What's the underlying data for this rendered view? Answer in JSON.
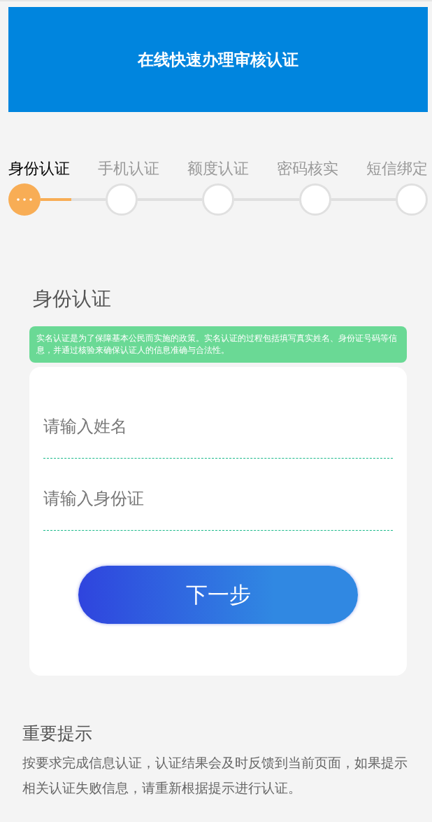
{
  "banner": {
    "title": "在线快速办理审核认证"
  },
  "steps": [
    {
      "label": "身份认证",
      "selected": true
    },
    {
      "label": "手机认证",
      "selected": false
    },
    {
      "label": "额度认证",
      "selected": false
    },
    {
      "label": "密码核实",
      "selected": false
    },
    {
      "label": "短信绑定",
      "selected": false
    }
  ],
  "progress": {
    "level": 0.48
  },
  "section": {
    "title": "身份认证",
    "notice": "实名认证是为了保障基本公民而实施的政策。实名认证的过程包括填写真实姓名、身份证号码等信息，并通过核验来确保认证人的信息准确与合法性。"
  },
  "form": {
    "fields": [
      {
        "placeholder": "请输入姓名"
      },
      {
        "placeholder": "请输入身份证"
      }
    ],
    "submit": "下一步"
  },
  "tips": {
    "title": "重要提示",
    "text": "按要求完成信息认证，认证结果会及时反馈到当前页面，如果提示相关认证失败信息，请重新根据提示进行认证。"
  }
}
